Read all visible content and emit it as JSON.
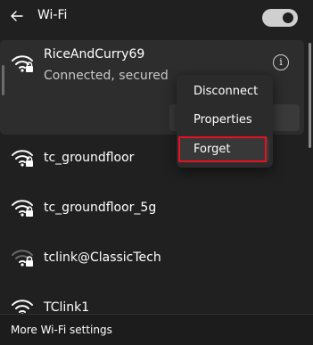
{
  "header": {
    "title": "Wi-Fi",
    "toggle_state": "on"
  },
  "connected_network": {
    "name": "RiceAndCurry69",
    "status": "Connected, secured",
    "icon": "wifi-secured-icon"
  },
  "networks": [
    {
      "name": "tc_groundfloor",
      "icon": "wifi-secured-icon"
    },
    {
      "name": "tc_groundfloor_5g",
      "icon": "wifi-secured-icon"
    },
    {
      "name": "tclink@ClassicTech",
      "icon": "wifi-secured-weak-icon"
    },
    {
      "name": "TClink1",
      "icon": "wifi-secured-icon"
    }
  ],
  "context_menu": {
    "items": [
      {
        "label": "Disconnect"
      },
      {
        "label": "Properties"
      },
      {
        "label": "Forget"
      }
    ],
    "highlighted_item": "Forget",
    "highlight_color": "#e81123"
  },
  "footer": {
    "link": "More Wi-Fi settings"
  },
  "colors": {
    "background": "#202020",
    "card": "#2d2d2d",
    "menu": "#2b2b2b"
  }
}
